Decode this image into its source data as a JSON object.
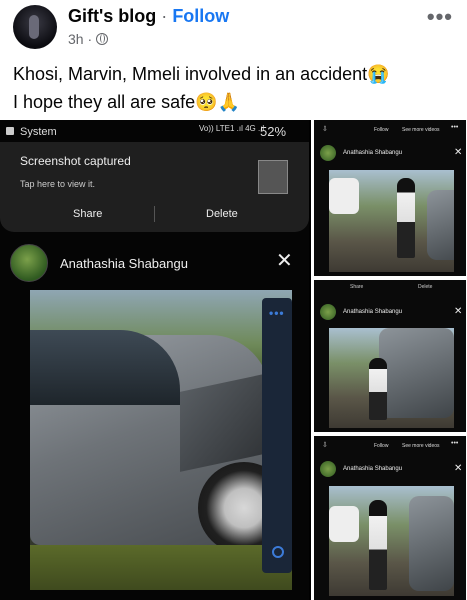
{
  "post": {
    "page_name": "Gift's blog",
    "separator": "·",
    "follow_label": "Follow",
    "time": "3h ·",
    "caption_line1": "Khosi, Marvin, Mmeli involved in an accident😭",
    "caption_line2": "I hope they all are safe🥺🙏",
    "more_label": "•••"
  },
  "screenshot": {
    "status_app": "System",
    "network": "Vo)) LTE1 .ıl 4G .ıl",
    "battery": "52%",
    "notif_title": "Screenshot captured",
    "notif_sub": "Tap here to view it.",
    "share_label": "Share",
    "delete_label": "Delete",
    "video_user": "Anathashia Shabangu",
    "close_label": "✕",
    "dots_label": "•••"
  },
  "thumbs": {
    "user": "Anathashia Shabangu",
    "close": "✕",
    "follow": "Follow",
    "see_more": "See more videos",
    "dots": "•••",
    "share": "Share",
    "delete": "Delete"
  }
}
